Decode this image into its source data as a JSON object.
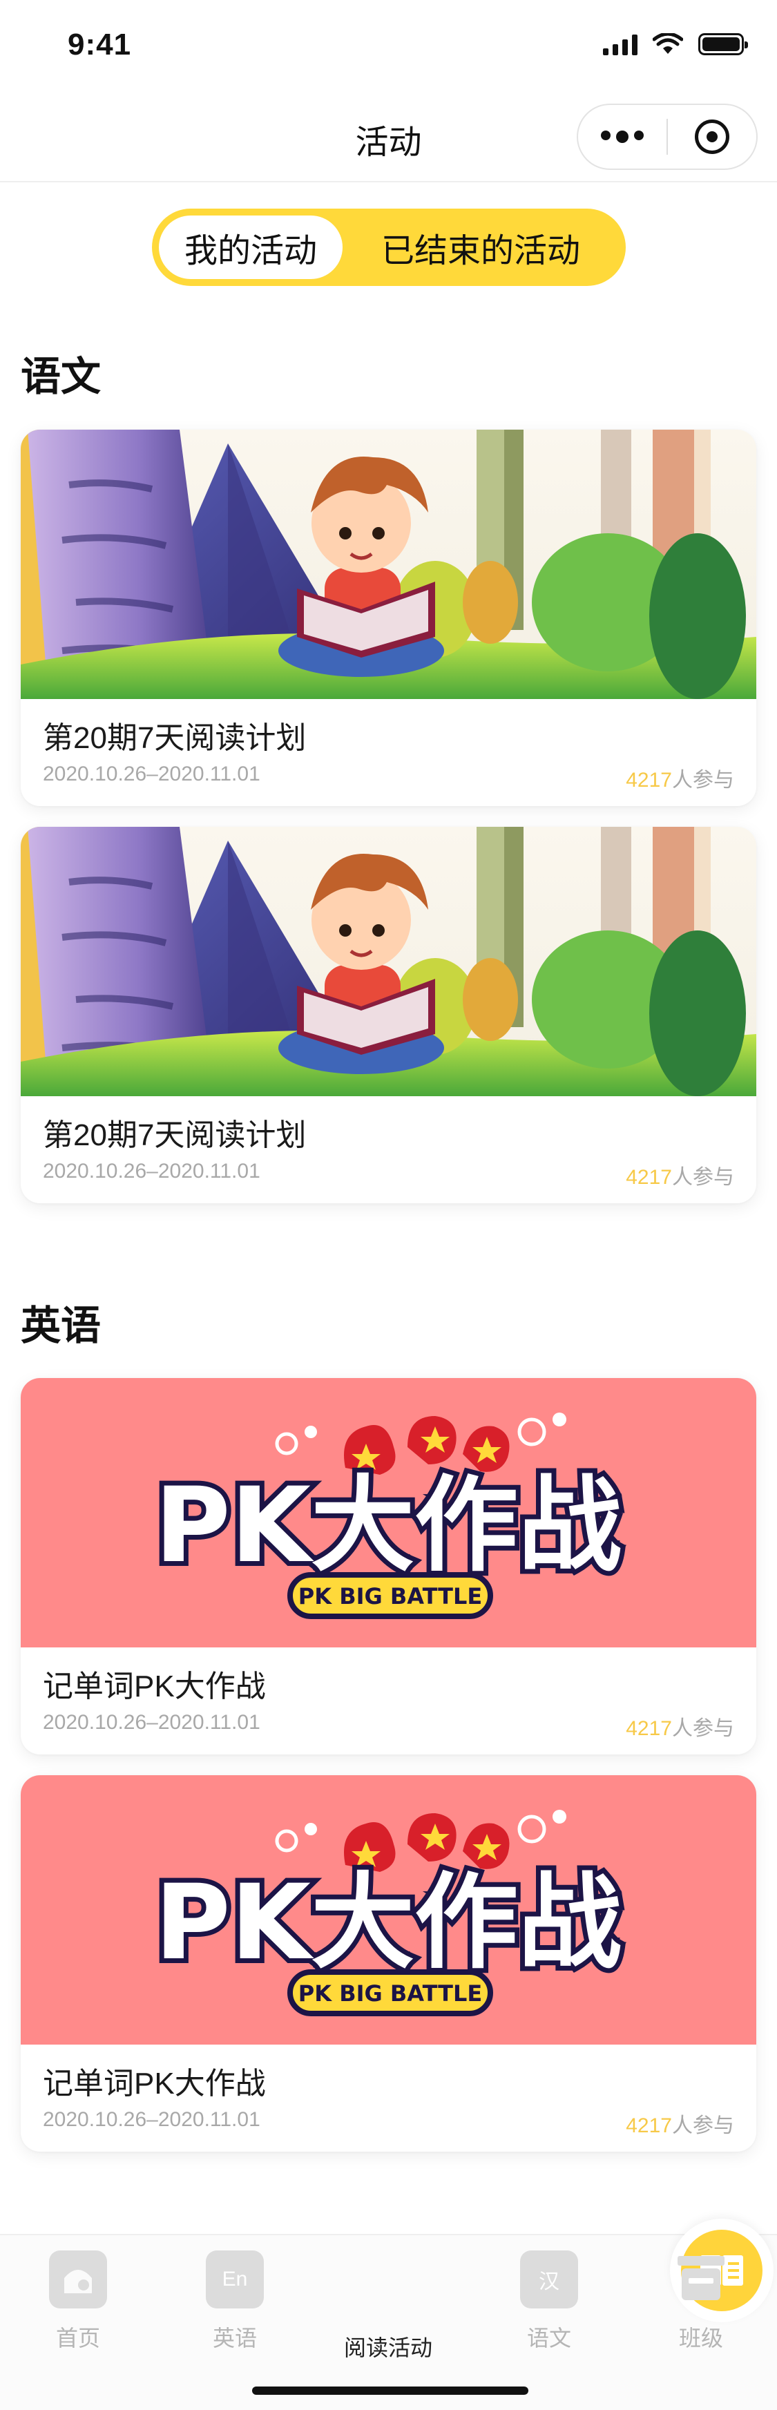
{
  "status_bar": {
    "time": "9:41"
  },
  "navbar": {
    "title": "活动"
  },
  "tabs": [
    {
      "label": "我的活动",
      "active": true
    },
    {
      "label": "已结束的活动",
      "active": false
    }
  ],
  "sections": [
    {
      "title": "语文",
      "cards": [
        {
          "title": "第20期7天阅读计划",
          "date": "2020.10.26–2020.11.01",
          "count": "4217",
          "count_suffix": "人参与",
          "banner": "reading-boy-illustration"
        },
        {
          "title": "第20期7天阅读计划",
          "date": "2020.10.26–2020.11.01",
          "count": "4217",
          "count_suffix": "人参与",
          "banner": "reading-boy-illustration"
        }
      ]
    },
    {
      "title": "英语",
      "cards": [
        {
          "title": "记单词PK大作战",
          "date": "2020.10.26–2020.11.01",
          "count": "4217",
          "count_suffix": "人参与",
          "banner": "pk-big-battle-logo",
          "logo_text": "PK大作战",
          "logo_subtitle": "PK BIG BATTLE"
        },
        {
          "title": "记单词PK大作战",
          "date": "2020.10.26–2020.11.01",
          "count": "4217",
          "count_suffix": "人参与",
          "banner": "pk-big-battle-logo",
          "logo_text": "PK大作战",
          "logo_subtitle": "PK BIG BATTLE"
        }
      ]
    }
  ],
  "tabbar": {
    "items": [
      {
        "label": "首页",
        "icon": "home-icon",
        "active": false
      },
      {
        "label": "英语",
        "icon": "english-icon",
        "icon_glyph": "En",
        "active": false
      },
      {
        "label": "阅读活动",
        "icon": "book-icon",
        "active": true
      },
      {
        "label": "语文",
        "icon": "chinese-icon",
        "icon_glyph": "汉",
        "active": false
      },
      {
        "label": "班级",
        "icon": "class-icon",
        "active": false
      }
    ]
  },
  "colors": {
    "accent": "#ffd93a",
    "count": "#f7c948",
    "pk_banner_bg": "#ff8a8a"
  }
}
